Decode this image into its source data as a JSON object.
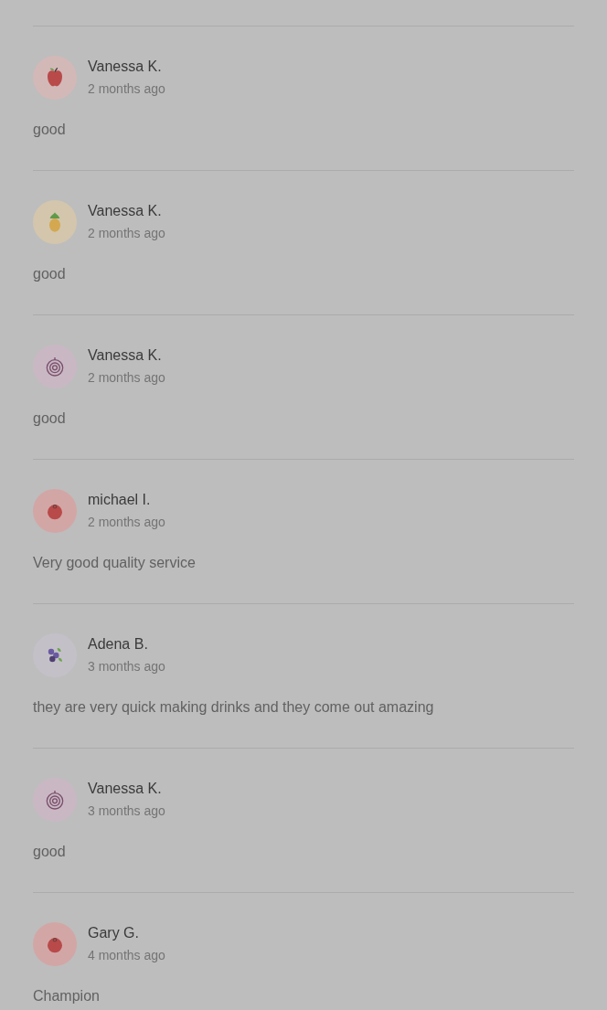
{
  "reviews": [
    {
      "author": "Vanessa K.",
      "time": "2 months ago",
      "text": "good",
      "avatar": {
        "kind": "apple"
      }
    },
    {
      "author": "Vanessa K.",
      "time": "2 months ago",
      "text": "good",
      "avatar": {
        "kind": "pineapple"
      }
    },
    {
      "author": "Vanessa K.",
      "time": "2 months ago",
      "text": "good",
      "avatar": {
        "kind": "onion"
      }
    },
    {
      "author": "michael I.",
      "time": "2 months ago",
      "text": "Very good quality service",
      "avatar": {
        "kind": "tomato"
      }
    },
    {
      "author": "Adena B.",
      "time": "3 months ago",
      "text": "they are very quick making drinks and they come out amazing",
      "avatar": {
        "kind": "blueberries"
      }
    },
    {
      "author": "Vanessa K.",
      "time": "3 months ago",
      "text": "good",
      "avatar": {
        "kind": "onion"
      }
    },
    {
      "author": "Gary G.",
      "time": "4 months ago",
      "text": "Champion",
      "avatar": {
        "kind": "tomato"
      }
    }
  ]
}
